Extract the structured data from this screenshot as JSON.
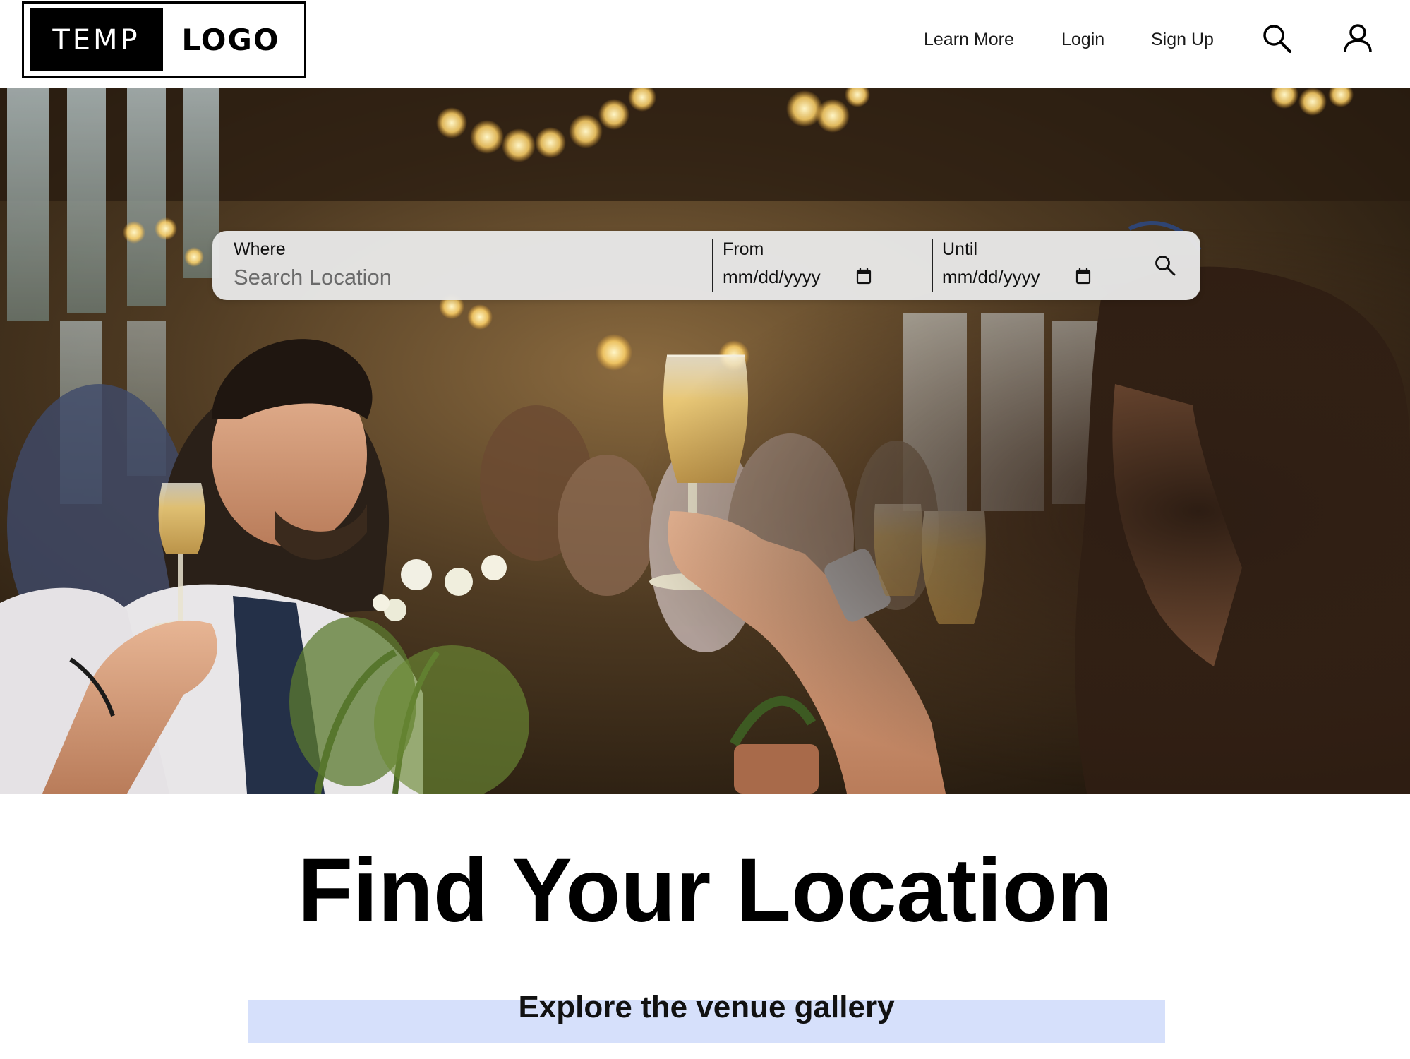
{
  "header": {
    "logo": {
      "left_text": "TEMP",
      "right_text": "LOGO"
    },
    "nav": {
      "learn_more": "Learn More",
      "login": "Login",
      "sign_up": "Sign Up"
    },
    "icons": {
      "search": "search-icon",
      "account": "user-icon"
    }
  },
  "search": {
    "where_label": "Where",
    "where_placeholder": "Search Location",
    "from_label": "From",
    "from_value": "mm/dd/yyyy",
    "until_label": "Until",
    "until_value": "mm/dd/yyyy",
    "submit_icon": "search-icon"
  },
  "main": {
    "headline": "Find Your Location",
    "gallery_link": "Explore the venue gallery"
  },
  "colors": {
    "gallery_highlight": "#d6e0fb",
    "search_bar_bg": "#e8e8e8",
    "text": "#000000"
  }
}
